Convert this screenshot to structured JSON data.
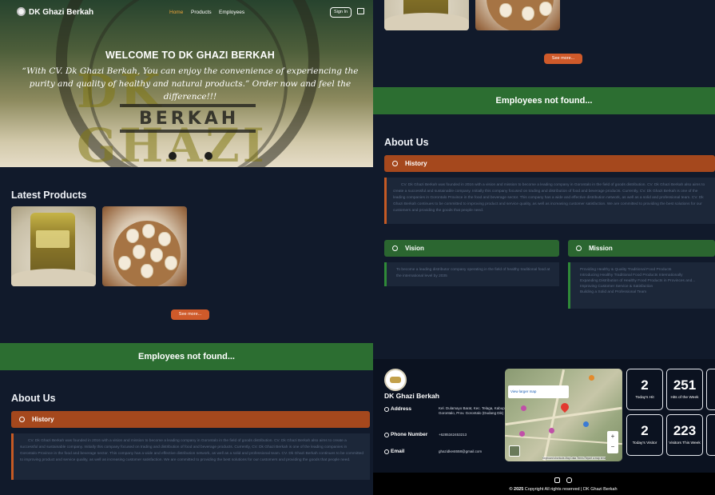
{
  "nav": {
    "brand": "DK Ghazi Berkah",
    "links": [
      "Home",
      "Products",
      "Employees"
    ],
    "sign_in": "Sign In"
  },
  "hero": {
    "logo_text": "DK GHAZI",
    "logo_sub": "BERKAH",
    "title": "WELCOME TO DK GHAZI BERKAH",
    "quote": "“With CV. Dk Ghazi Berkah, You can enjoy the convenience of experiencing the purity and quality of healthy and natural products.” Order now and feel the difference!!!"
  },
  "products": {
    "title": "Latest Products",
    "see_more": "See more..."
  },
  "employees": {
    "empty": "Employees not found..."
  },
  "about": {
    "title": "About Us",
    "history_label": "History",
    "history_text": "CV. Dk Ghazi Berkah was founded in 2016 with a vision and mission to become a leading company in Gorontalo in the field of goods distribution. CV. Dk Ghazi Berkah also aims to create a successful and sustainable company. Initially this company focused on trading and distribution of food and beverage products. Currently, CV. Dk Ghazi Berkah is one of the leading companies in Gorontalo Province in the food and beverage sector. This company has a wide and effective distribution network, as well as a solid and professional team. CV. Dk Ghazi Berkah continues to be committed to improving product and service quality, as well as increasing customer satisfaction. We are committed to providing the best solutions for our customers and providing the goods that people need.",
    "vision_label": "Vision",
    "vision_text": "To become a leading distributor company operating in the field of healthy traditional food at the international level by 2035",
    "mission_label": "Mission",
    "mission_items": [
      "Providing Healthy & Quality Traditional Food Products",
      "Introducing Healthy Traditional Food Products Internationally",
      "Expanding Distribution of Healthy Food Products in Provinces and...",
      "Improving Customer Service & Satisfaction",
      "Building a Solid and Professional Team"
    ]
  },
  "footer": {
    "brand": "DK Ghazi Berkah",
    "address_label": "Address",
    "address_value": "Kel. Dulamayo Barat, Kec. Telaga, Kabupaten Gorontalo, Prov. Gorontalo (Dudang Dik)",
    "phone_label": "Phone Number",
    "phone_value": "+6285342453213",
    "email_label": "Email",
    "email_value": "ghazidkest658@gmail.com",
    "map_link": "View larger map",
    "map_attr": "Keyboard shortcuts  Map Data  Terms  Report a map error",
    "stats": [
      {
        "value": "2",
        "label": "Today's Hit"
      },
      {
        "value": "251",
        "label": "Hits of the Week"
      },
      {
        "value": "2",
        "label": "Today's Visitor"
      },
      {
        "value": "223",
        "label": "Visitors This Week"
      }
    ],
    "copyright_year": "© 2025",
    "copyright_text": " Copyright All rights reserved | DK Ghazi Berkah"
  }
}
